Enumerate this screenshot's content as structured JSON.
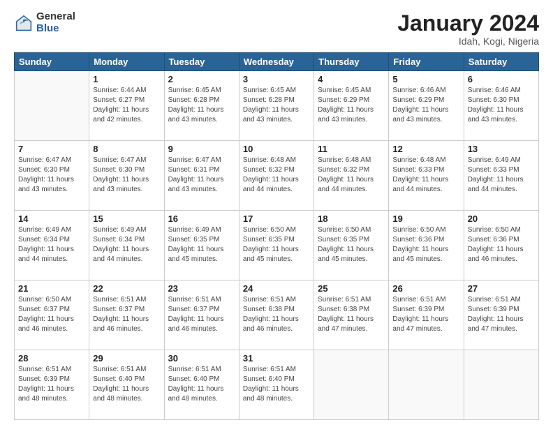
{
  "logo": {
    "general": "General",
    "blue": "Blue"
  },
  "header": {
    "month": "January 2024",
    "location": "Idah, Kogi, Nigeria"
  },
  "days_of_week": [
    "Sunday",
    "Monday",
    "Tuesday",
    "Wednesday",
    "Thursday",
    "Friday",
    "Saturday"
  ],
  "weeks": [
    [
      {
        "day": "",
        "sunrise": "",
        "sunset": "",
        "daylight": ""
      },
      {
        "day": "1",
        "sunrise": "Sunrise: 6:44 AM",
        "sunset": "Sunset: 6:27 PM",
        "daylight": "Daylight: 11 hours and 42 minutes."
      },
      {
        "day": "2",
        "sunrise": "Sunrise: 6:45 AM",
        "sunset": "Sunset: 6:28 PM",
        "daylight": "Daylight: 11 hours and 43 minutes."
      },
      {
        "day": "3",
        "sunrise": "Sunrise: 6:45 AM",
        "sunset": "Sunset: 6:28 PM",
        "daylight": "Daylight: 11 hours and 43 minutes."
      },
      {
        "day": "4",
        "sunrise": "Sunrise: 6:45 AM",
        "sunset": "Sunset: 6:29 PM",
        "daylight": "Daylight: 11 hours and 43 minutes."
      },
      {
        "day": "5",
        "sunrise": "Sunrise: 6:46 AM",
        "sunset": "Sunset: 6:29 PM",
        "daylight": "Daylight: 11 hours and 43 minutes."
      },
      {
        "day": "6",
        "sunrise": "Sunrise: 6:46 AM",
        "sunset": "Sunset: 6:30 PM",
        "daylight": "Daylight: 11 hours and 43 minutes."
      }
    ],
    [
      {
        "day": "7",
        "sunrise": "Sunrise: 6:47 AM",
        "sunset": "Sunset: 6:30 PM",
        "daylight": "Daylight: 11 hours and 43 minutes."
      },
      {
        "day": "8",
        "sunrise": "Sunrise: 6:47 AM",
        "sunset": "Sunset: 6:30 PM",
        "daylight": "Daylight: 11 hours and 43 minutes."
      },
      {
        "day": "9",
        "sunrise": "Sunrise: 6:47 AM",
        "sunset": "Sunset: 6:31 PM",
        "daylight": "Daylight: 11 hours and 43 minutes."
      },
      {
        "day": "10",
        "sunrise": "Sunrise: 6:48 AM",
        "sunset": "Sunset: 6:32 PM",
        "daylight": "Daylight: 11 hours and 44 minutes."
      },
      {
        "day": "11",
        "sunrise": "Sunrise: 6:48 AM",
        "sunset": "Sunset: 6:32 PM",
        "daylight": "Daylight: 11 hours and 44 minutes."
      },
      {
        "day": "12",
        "sunrise": "Sunrise: 6:48 AM",
        "sunset": "Sunset: 6:33 PM",
        "daylight": "Daylight: 11 hours and 44 minutes."
      },
      {
        "day": "13",
        "sunrise": "Sunrise: 6:49 AM",
        "sunset": "Sunset: 6:33 PM",
        "daylight": "Daylight: 11 hours and 44 minutes."
      }
    ],
    [
      {
        "day": "14",
        "sunrise": "Sunrise: 6:49 AM",
        "sunset": "Sunset: 6:34 PM",
        "daylight": "Daylight: 11 hours and 44 minutes."
      },
      {
        "day": "15",
        "sunrise": "Sunrise: 6:49 AM",
        "sunset": "Sunset: 6:34 PM",
        "daylight": "Daylight: 11 hours and 44 minutes."
      },
      {
        "day": "16",
        "sunrise": "Sunrise: 6:49 AM",
        "sunset": "Sunset: 6:35 PM",
        "daylight": "Daylight: 11 hours and 45 minutes."
      },
      {
        "day": "17",
        "sunrise": "Sunrise: 6:50 AM",
        "sunset": "Sunset: 6:35 PM",
        "daylight": "Daylight: 11 hours and 45 minutes."
      },
      {
        "day": "18",
        "sunrise": "Sunrise: 6:50 AM",
        "sunset": "Sunset: 6:35 PM",
        "daylight": "Daylight: 11 hours and 45 minutes."
      },
      {
        "day": "19",
        "sunrise": "Sunrise: 6:50 AM",
        "sunset": "Sunset: 6:36 PM",
        "daylight": "Daylight: 11 hours and 45 minutes."
      },
      {
        "day": "20",
        "sunrise": "Sunrise: 6:50 AM",
        "sunset": "Sunset: 6:36 PM",
        "daylight": "Daylight: 11 hours and 46 minutes."
      }
    ],
    [
      {
        "day": "21",
        "sunrise": "Sunrise: 6:50 AM",
        "sunset": "Sunset: 6:37 PM",
        "daylight": "Daylight: 11 hours and 46 minutes."
      },
      {
        "day": "22",
        "sunrise": "Sunrise: 6:51 AM",
        "sunset": "Sunset: 6:37 PM",
        "daylight": "Daylight: 11 hours and 46 minutes."
      },
      {
        "day": "23",
        "sunrise": "Sunrise: 6:51 AM",
        "sunset": "Sunset: 6:37 PM",
        "daylight": "Daylight: 11 hours and 46 minutes."
      },
      {
        "day": "24",
        "sunrise": "Sunrise: 6:51 AM",
        "sunset": "Sunset: 6:38 PM",
        "daylight": "Daylight: 11 hours and 46 minutes."
      },
      {
        "day": "25",
        "sunrise": "Sunrise: 6:51 AM",
        "sunset": "Sunset: 6:38 PM",
        "daylight": "Daylight: 11 hours and 47 minutes."
      },
      {
        "day": "26",
        "sunrise": "Sunrise: 6:51 AM",
        "sunset": "Sunset: 6:39 PM",
        "daylight": "Daylight: 11 hours and 47 minutes."
      },
      {
        "day": "27",
        "sunrise": "Sunrise: 6:51 AM",
        "sunset": "Sunset: 6:39 PM",
        "daylight": "Daylight: 11 hours and 47 minutes."
      }
    ],
    [
      {
        "day": "28",
        "sunrise": "Sunrise: 6:51 AM",
        "sunset": "Sunset: 6:39 PM",
        "daylight": "Daylight: 11 hours and 48 minutes."
      },
      {
        "day": "29",
        "sunrise": "Sunrise: 6:51 AM",
        "sunset": "Sunset: 6:40 PM",
        "daylight": "Daylight: 11 hours and 48 minutes."
      },
      {
        "day": "30",
        "sunrise": "Sunrise: 6:51 AM",
        "sunset": "Sunset: 6:40 PM",
        "daylight": "Daylight: 11 hours and 48 minutes."
      },
      {
        "day": "31",
        "sunrise": "Sunrise: 6:51 AM",
        "sunset": "Sunset: 6:40 PM",
        "daylight": "Daylight: 11 hours and 48 minutes."
      },
      {
        "day": "",
        "sunrise": "",
        "sunset": "",
        "daylight": ""
      },
      {
        "day": "",
        "sunrise": "",
        "sunset": "",
        "daylight": ""
      },
      {
        "day": "",
        "sunrise": "",
        "sunset": "",
        "daylight": ""
      }
    ]
  ]
}
